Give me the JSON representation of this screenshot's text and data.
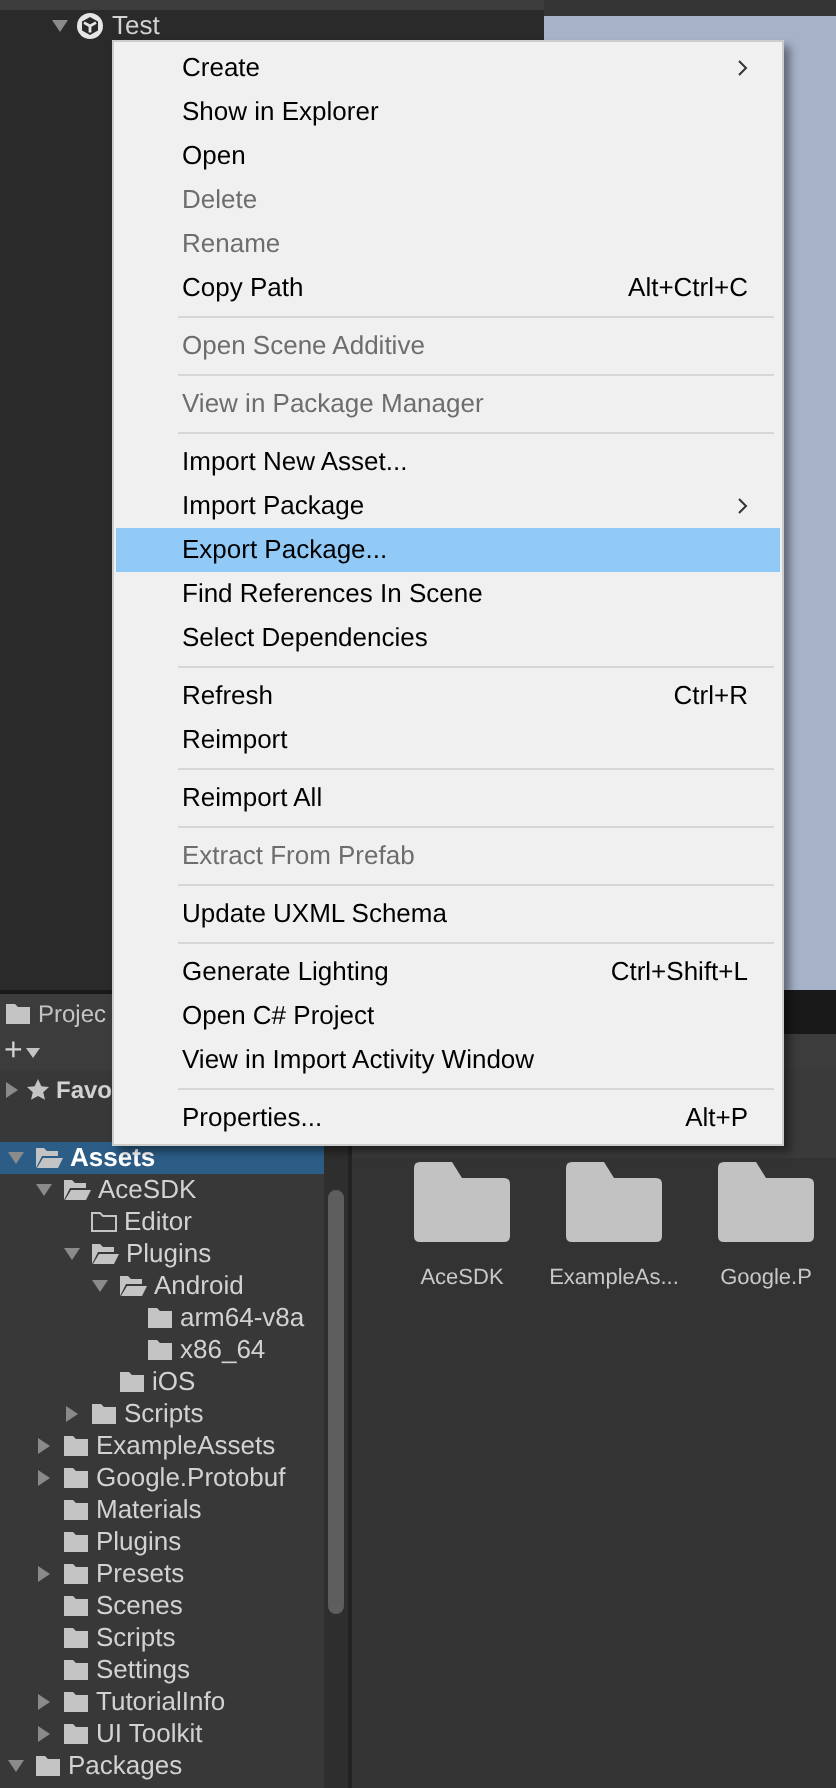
{
  "hierarchy": {
    "root": {
      "label": "Test",
      "expanded": true
    }
  },
  "context_menu": {
    "items": [
      {
        "kind": "item",
        "label": "Create",
        "submenu": true,
        "disabled": false,
        "selected": false
      },
      {
        "kind": "item",
        "label": "Show in Explorer",
        "disabled": false,
        "selected": false
      },
      {
        "kind": "item",
        "label": "Open",
        "disabled": false,
        "selected": false
      },
      {
        "kind": "item",
        "label": "Delete",
        "disabled": true,
        "selected": false
      },
      {
        "kind": "item",
        "label": "Rename",
        "disabled": true,
        "selected": false
      },
      {
        "kind": "item",
        "label": "Copy Path",
        "shortcut": "Alt+Ctrl+C",
        "disabled": false,
        "selected": false
      },
      {
        "kind": "separator"
      },
      {
        "kind": "item",
        "label": "Open Scene Additive",
        "disabled": true,
        "selected": false
      },
      {
        "kind": "separator"
      },
      {
        "kind": "item",
        "label": "View in Package Manager",
        "disabled": true,
        "selected": false
      },
      {
        "kind": "separator"
      },
      {
        "kind": "item",
        "label": "Import New Asset...",
        "disabled": false,
        "selected": false
      },
      {
        "kind": "item",
        "label": "Import Package",
        "submenu": true,
        "disabled": false,
        "selected": false
      },
      {
        "kind": "item",
        "label": "Export Package...",
        "disabled": false,
        "selected": true
      },
      {
        "kind": "item",
        "label": "Find References In Scene",
        "disabled": false,
        "selected": false
      },
      {
        "kind": "item",
        "label": "Select Dependencies",
        "disabled": false,
        "selected": false
      },
      {
        "kind": "separator"
      },
      {
        "kind": "item",
        "label": "Refresh",
        "shortcut": "Ctrl+R",
        "disabled": false,
        "selected": false
      },
      {
        "kind": "item",
        "label": "Reimport",
        "disabled": false,
        "selected": false
      },
      {
        "kind": "separator"
      },
      {
        "kind": "item",
        "label": "Reimport All",
        "disabled": false,
        "selected": false
      },
      {
        "kind": "separator"
      },
      {
        "kind": "item",
        "label": "Extract From Prefab",
        "disabled": true,
        "selected": false
      },
      {
        "kind": "separator"
      },
      {
        "kind": "item",
        "label": "Update UXML Schema",
        "disabled": false,
        "selected": false
      },
      {
        "kind": "separator"
      },
      {
        "kind": "item",
        "label": "Generate Lighting",
        "shortcut": "Ctrl+Shift+L",
        "disabled": false,
        "selected": false
      },
      {
        "kind": "item",
        "label": "Open C# Project",
        "disabled": false,
        "selected": false
      },
      {
        "kind": "item",
        "label": "View in Import Activity Window",
        "disabled": false,
        "selected": false
      },
      {
        "kind": "separator"
      },
      {
        "kind": "item",
        "label": "Properties...",
        "shortcut": "Alt+P",
        "disabled": false,
        "selected": false
      }
    ]
  },
  "project_panel": {
    "tab": "Projec",
    "add_button": "+",
    "favorites": {
      "label": "Favo",
      "expanded": false
    },
    "tree": [
      {
        "label": "Assets",
        "expanded": true,
        "selected": true,
        "children": [
          {
            "label": "AceSDK",
            "expanded": true,
            "selected": false,
            "children": [
              {
                "label": "Editor",
                "empty": true,
                "selected": false
              },
              {
                "label": "Plugins",
                "expanded": true,
                "selected": false,
                "children": [
                  {
                    "label": "Android",
                    "expanded": true,
                    "selected": false,
                    "children": [
                      {
                        "label": "arm64-v8a",
                        "selected": false
                      },
                      {
                        "label": "x86_64",
                        "selected": false
                      }
                    ]
                  },
                  {
                    "label": "iOS",
                    "selected": false
                  }
                ]
              },
              {
                "label": "Scripts",
                "expanded": false,
                "selected": false
              }
            ]
          },
          {
            "label": "ExampleAssets",
            "expanded": false,
            "selected": false
          },
          {
            "label": "Google.Protobuf",
            "expanded": false,
            "selected": false
          },
          {
            "label": "Materials",
            "selected": false
          },
          {
            "label": "Plugins",
            "selected": false
          },
          {
            "label": "Presets",
            "expanded": false,
            "selected": false
          },
          {
            "label": "Scenes",
            "selected": false
          },
          {
            "label": "Scripts",
            "selected": false
          },
          {
            "label": "Settings",
            "selected": false
          },
          {
            "label": "TutorialInfo",
            "expanded": false,
            "selected": false
          },
          {
            "label": "UI Toolkit",
            "expanded": false,
            "selected": false
          }
        ]
      },
      {
        "label": "Packages",
        "expanded": true,
        "selected": false
      }
    ],
    "grid": [
      {
        "label": "AceSDK"
      },
      {
        "label": "ExampleAs..."
      },
      {
        "label": "Google.P"
      }
    ]
  }
}
